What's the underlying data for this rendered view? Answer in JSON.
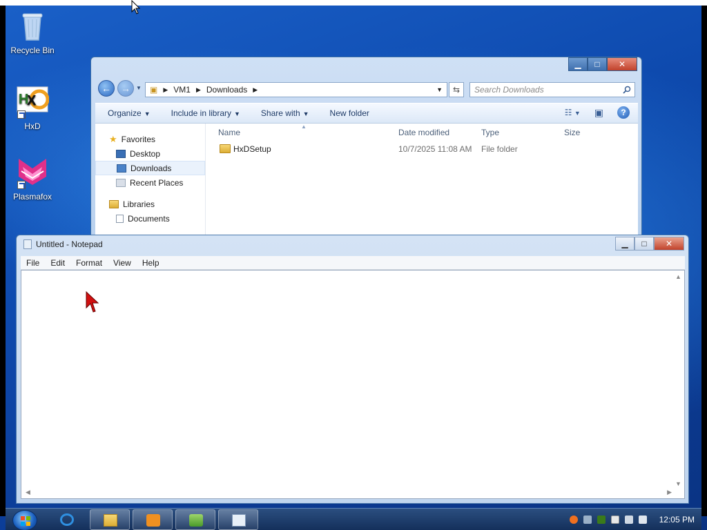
{
  "desktop": {
    "icons": [
      {
        "label": "Recycle Bin"
      },
      {
        "label": "HxD"
      },
      {
        "label": "Plasmafox"
      }
    ]
  },
  "explorer": {
    "path": [
      "VM1",
      "Downloads"
    ],
    "search_placeholder": "Search Downloads",
    "toolbar": {
      "organize": "Organize",
      "include_in_library": "Include in library",
      "share_with": "Share with",
      "new_folder": "New folder"
    },
    "nav_pane": {
      "favorites": "Favorites",
      "desktop": "Desktop",
      "downloads": "Downloads",
      "recent_places": "Recent Places",
      "libraries": "Libraries",
      "documents": "Documents"
    },
    "columns": {
      "name": "Name",
      "date_modified": "Date modified",
      "type": "Type",
      "size": "Size"
    },
    "files": [
      {
        "name": "HxDSetup",
        "date_modified": "10/7/2025 11:08 AM",
        "type": "File folder",
        "size": ""
      }
    ]
  },
  "notepad": {
    "title": "Untitled - Notepad",
    "menu": {
      "file": "File",
      "edit": "Edit",
      "format": "Format",
      "view": "View",
      "help": "Help"
    },
    "text": ""
  },
  "taskbar": {
    "clock": "12:05 PM"
  },
  "colors": {
    "desktop_blue": "#1a60c8",
    "taskbar": "#14305b",
    "close_red": "#c1422b"
  }
}
